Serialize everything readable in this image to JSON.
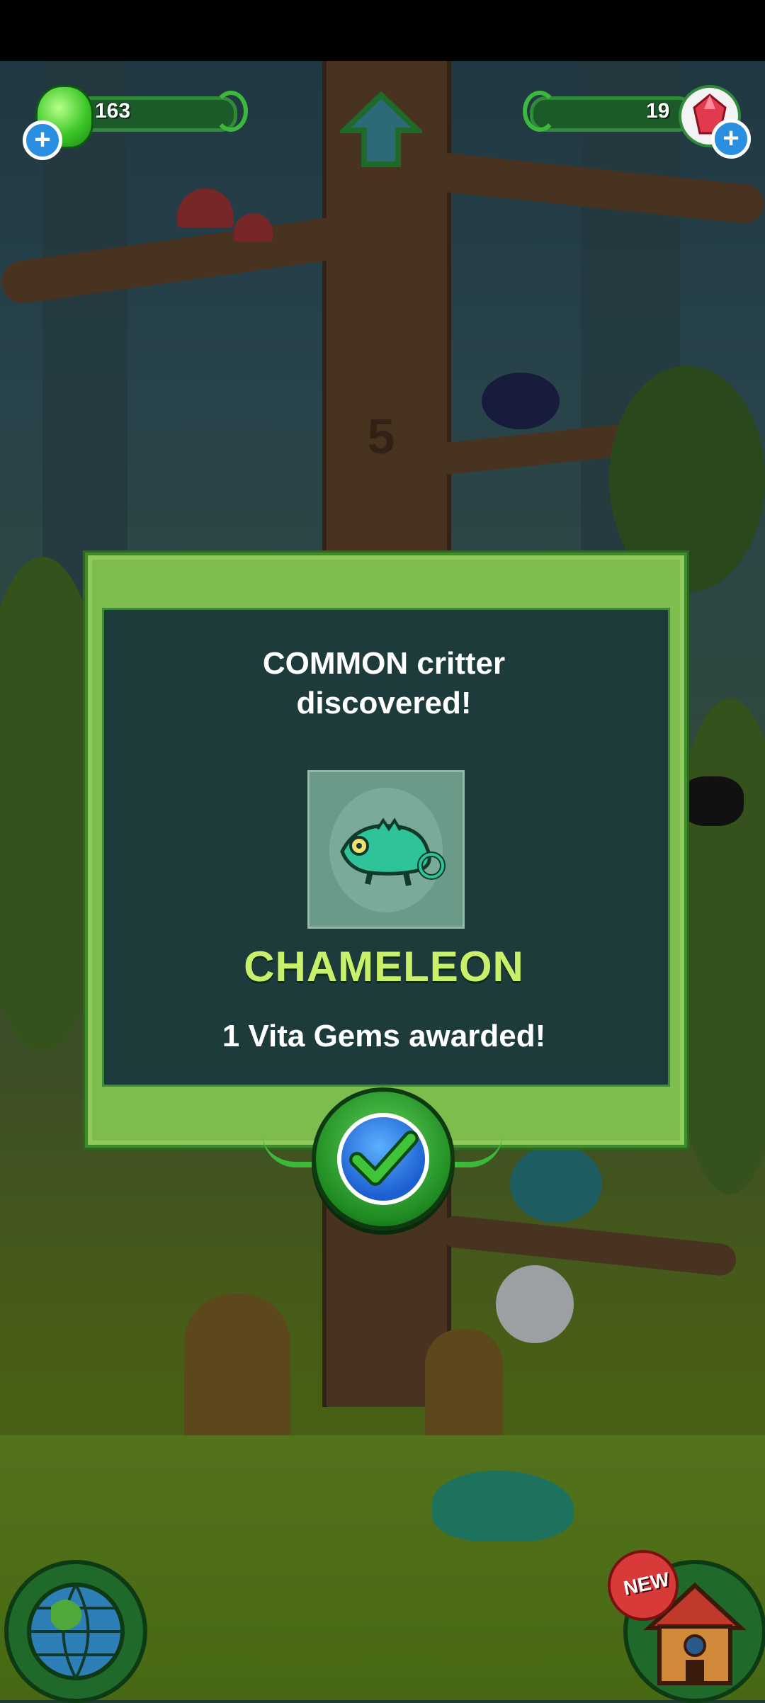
{
  "hud": {
    "goo_count": "163",
    "gem_count": "19",
    "add_symbol": "+"
  },
  "tree": {
    "level_number": "5"
  },
  "dialog": {
    "line1": "COMMON critter",
    "line2": "discovered!",
    "critter_name": "CHAMELEON",
    "reward_text": "1 Vita Gems awarded!"
  },
  "bottom": {
    "new_badge": "NEW"
  },
  "colors": {
    "dialog_frame": "#7dbd4e",
    "dialog_panel": "#1e3b3b",
    "critter_name": "#c8f06a",
    "confirm_check": "#3fc43a"
  },
  "icons": [
    "goo-icon",
    "gem-icon",
    "plus-icon",
    "home-arrow-icon",
    "check-icon",
    "globe-icon",
    "house-icon"
  ]
}
